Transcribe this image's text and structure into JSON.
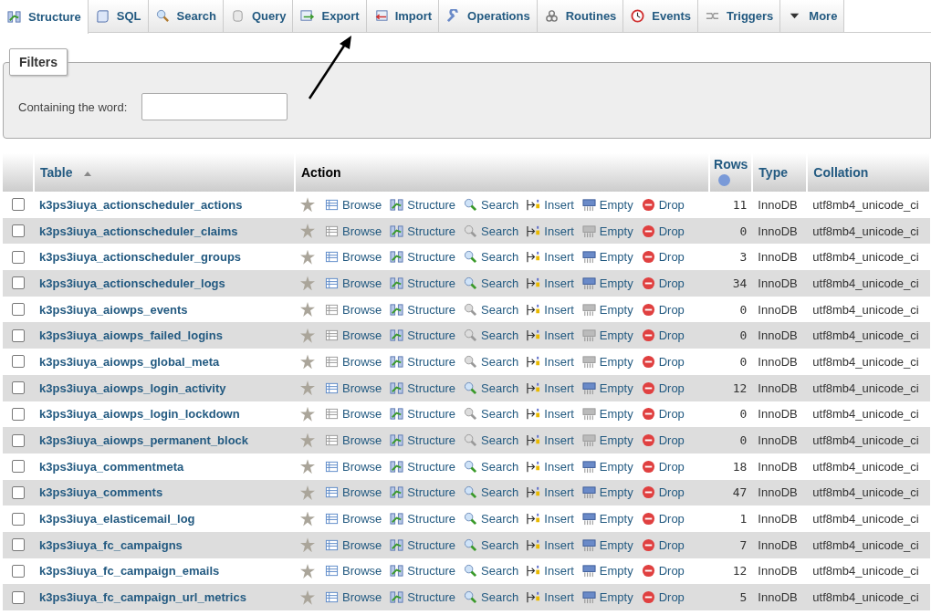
{
  "tabs": [
    {
      "label": "Structure",
      "selected": true
    },
    {
      "label": "SQL",
      "selected": false
    },
    {
      "label": "Search",
      "selected": false
    },
    {
      "label": "Query",
      "selected": false
    },
    {
      "label": "Export",
      "selected": false
    },
    {
      "label": "Import",
      "selected": false
    },
    {
      "label": "Operations",
      "selected": false
    },
    {
      "label": "Routines",
      "selected": false
    },
    {
      "label": "Events",
      "selected": false
    },
    {
      "label": "Triggers",
      "selected": false
    },
    {
      "label": "More",
      "selected": false
    }
  ],
  "filters": {
    "legend": "Filters",
    "label": "Containing the word:"
  },
  "table": {
    "columns": [
      "Table",
      "Action",
      "Rows",
      "Type",
      "Collation"
    ],
    "rows": [
      {
        "name": "k3ps3iuya_actionscheduler_actions",
        "rows": "11",
        "type": "InnoDB",
        "collation": "utf8mb4_unicode_ci",
        "checked": false,
        "actions": [
          {
            "label": "Browse",
            "disabled": false
          },
          {
            "label": "Structure",
            "disabled": false
          },
          {
            "label": "Search",
            "disabled": false
          },
          {
            "label": "Insert",
            "disabled": false
          },
          {
            "label": "Empty",
            "disabled": false
          },
          {
            "label": "Drop",
            "disabled": false
          }
        ]
      },
      {
        "name": "k3ps3iuya_actionscheduler_claims",
        "rows": "0",
        "type": "InnoDB",
        "collation": "utf8mb4_unicode_ci",
        "checked": false,
        "actions": [
          {
            "label": "Browse",
            "disabled": true
          },
          {
            "label": "Structure",
            "disabled": false
          },
          {
            "label": "Search",
            "disabled": true
          },
          {
            "label": "Insert",
            "disabled": false
          },
          {
            "label": "Empty",
            "disabled": true
          },
          {
            "label": "Drop",
            "disabled": false
          }
        ]
      },
      {
        "name": "k3ps3iuya_actionscheduler_groups",
        "rows": "3",
        "type": "InnoDB",
        "collation": "utf8mb4_unicode_ci",
        "checked": false,
        "actions": [
          {
            "label": "Browse",
            "disabled": false
          },
          {
            "label": "Structure",
            "disabled": false
          },
          {
            "label": "Search",
            "disabled": false
          },
          {
            "label": "Insert",
            "disabled": false
          },
          {
            "label": "Empty",
            "disabled": false
          },
          {
            "label": "Drop",
            "disabled": false
          }
        ]
      },
      {
        "name": "k3ps3iuya_actionscheduler_logs",
        "rows": "34",
        "type": "InnoDB",
        "collation": "utf8mb4_unicode_ci",
        "checked": false,
        "actions": [
          {
            "label": "Browse",
            "disabled": false
          },
          {
            "label": "Structure",
            "disabled": false
          },
          {
            "label": "Search",
            "disabled": false
          },
          {
            "label": "Insert",
            "disabled": false
          },
          {
            "label": "Empty",
            "disabled": false
          },
          {
            "label": "Drop",
            "disabled": false
          }
        ]
      },
      {
        "name": "k3ps3iuya_aiowps_events",
        "rows": "0",
        "type": "InnoDB",
        "collation": "utf8mb4_unicode_ci",
        "checked": false,
        "actions": [
          {
            "label": "Browse",
            "disabled": true
          },
          {
            "label": "Structure",
            "disabled": false
          },
          {
            "label": "Search",
            "disabled": true
          },
          {
            "label": "Insert",
            "disabled": false
          },
          {
            "label": "Empty",
            "disabled": true
          },
          {
            "label": "Drop",
            "disabled": false
          }
        ]
      },
      {
        "name": "k3ps3iuya_aiowps_failed_logins",
        "rows": "0",
        "type": "InnoDB",
        "collation": "utf8mb4_unicode_ci",
        "checked": false,
        "actions": [
          {
            "label": "Browse",
            "disabled": true
          },
          {
            "label": "Structure",
            "disabled": false
          },
          {
            "label": "Search",
            "disabled": true
          },
          {
            "label": "Insert",
            "disabled": false
          },
          {
            "label": "Empty",
            "disabled": true
          },
          {
            "label": "Drop",
            "disabled": false
          }
        ]
      },
      {
        "name": "k3ps3iuya_aiowps_global_meta",
        "rows": "0",
        "type": "InnoDB",
        "collation": "utf8mb4_unicode_ci",
        "checked": false,
        "actions": [
          {
            "label": "Browse",
            "disabled": true
          },
          {
            "label": "Structure",
            "disabled": false
          },
          {
            "label": "Search",
            "disabled": true
          },
          {
            "label": "Insert",
            "disabled": false
          },
          {
            "label": "Empty",
            "disabled": true
          },
          {
            "label": "Drop",
            "disabled": false
          }
        ]
      },
      {
        "name": "k3ps3iuya_aiowps_login_activity",
        "rows": "12",
        "type": "InnoDB",
        "collation": "utf8mb4_unicode_ci",
        "checked": false,
        "actions": [
          {
            "label": "Browse",
            "disabled": false
          },
          {
            "label": "Structure",
            "disabled": false
          },
          {
            "label": "Search",
            "disabled": false
          },
          {
            "label": "Insert",
            "disabled": false
          },
          {
            "label": "Empty",
            "disabled": false
          },
          {
            "label": "Drop",
            "disabled": false
          }
        ]
      },
      {
        "name": "k3ps3iuya_aiowps_login_lockdown",
        "rows": "0",
        "type": "InnoDB",
        "collation": "utf8mb4_unicode_ci",
        "checked": false,
        "actions": [
          {
            "label": "Browse",
            "disabled": true
          },
          {
            "label": "Structure",
            "disabled": false
          },
          {
            "label": "Search",
            "disabled": true
          },
          {
            "label": "Insert",
            "disabled": false
          },
          {
            "label": "Empty",
            "disabled": true
          },
          {
            "label": "Drop",
            "disabled": false
          }
        ]
      },
      {
        "name": "k3ps3iuya_aiowps_permanent_block",
        "rows": "0",
        "type": "InnoDB",
        "collation": "utf8mb4_unicode_ci",
        "checked": false,
        "actions": [
          {
            "label": "Browse",
            "disabled": true
          },
          {
            "label": "Structure",
            "disabled": false
          },
          {
            "label": "Search",
            "disabled": true
          },
          {
            "label": "Insert",
            "disabled": false
          },
          {
            "label": "Empty",
            "disabled": true
          },
          {
            "label": "Drop",
            "disabled": false
          }
        ]
      },
      {
        "name": "k3ps3iuya_commentmeta",
        "rows": "18",
        "type": "InnoDB",
        "collation": "utf8mb4_unicode_ci",
        "checked": false,
        "actions": [
          {
            "label": "Browse",
            "disabled": false
          },
          {
            "label": "Structure",
            "disabled": false
          },
          {
            "label": "Search",
            "disabled": false
          },
          {
            "label": "Insert",
            "disabled": false
          },
          {
            "label": "Empty",
            "disabled": false
          },
          {
            "label": "Drop",
            "disabled": false
          }
        ]
      },
      {
        "name": "k3ps3iuya_comments",
        "rows": "47",
        "type": "InnoDB",
        "collation": "utf8mb4_unicode_ci",
        "checked": false,
        "actions": [
          {
            "label": "Browse",
            "disabled": false
          },
          {
            "label": "Structure",
            "disabled": false
          },
          {
            "label": "Search",
            "disabled": false
          },
          {
            "label": "Insert",
            "disabled": false
          },
          {
            "label": "Empty",
            "disabled": false
          },
          {
            "label": "Drop",
            "disabled": false
          }
        ]
      },
      {
        "name": "k3ps3iuya_elasticemail_log",
        "rows": "1",
        "type": "InnoDB",
        "collation": "utf8mb4_unicode_ci",
        "checked": false,
        "actions": [
          {
            "label": "Browse",
            "disabled": false
          },
          {
            "label": "Structure",
            "disabled": false
          },
          {
            "label": "Search",
            "disabled": false
          },
          {
            "label": "Insert",
            "disabled": false
          },
          {
            "label": "Empty",
            "disabled": false
          },
          {
            "label": "Drop",
            "disabled": false
          }
        ]
      },
      {
        "name": "k3ps3iuya_fc_campaigns",
        "rows": "7",
        "type": "InnoDB",
        "collation": "utf8mb4_unicode_ci",
        "checked": false,
        "actions": [
          {
            "label": "Browse",
            "disabled": false
          },
          {
            "label": "Structure",
            "disabled": false
          },
          {
            "label": "Search",
            "disabled": false
          },
          {
            "label": "Insert",
            "disabled": false
          },
          {
            "label": "Empty",
            "disabled": false
          },
          {
            "label": "Drop",
            "disabled": false
          }
        ]
      },
      {
        "name": "k3ps3iuya_fc_campaign_emails",
        "rows": "12",
        "type": "InnoDB",
        "collation": "utf8mb4_unicode_ci",
        "checked": false,
        "actions": [
          {
            "label": "Browse",
            "disabled": false
          },
          {
            "label": "Structure",
            "disabled": false
          },
          {
            "label": "Search",
            "disabled": false
          },
          {
            "label": "Insert",
            "disabled": false
          },
          {
            "label": "Empty",
            "disabled": false
          },
          {
            "label": "Drop",
            "disabled": false
          }
        ]
      },
      {
        "name": "k3ps3iuya_fc_campaign_url_metrics",
        "rows": "5",
        "type": "InnoDB",
        "collation": "utf8mb4_unicode_ci",
        "checked": false,
        "actions": [
          {
            "label": "Browse",
            "disabled": false
          },
          {
            "label": "Structure",
            "disabled": false
          },
          {
            "label": "Search",
            "disabled": false
          },
          {
            "label": "Insert",
            "disabled": false
          },
          {
            "label": "Empty",
            "disabled": false
          },
          {
            "label": "Drop",
            "disabled": false
          }
        ]
      }
    ]
  }
}
